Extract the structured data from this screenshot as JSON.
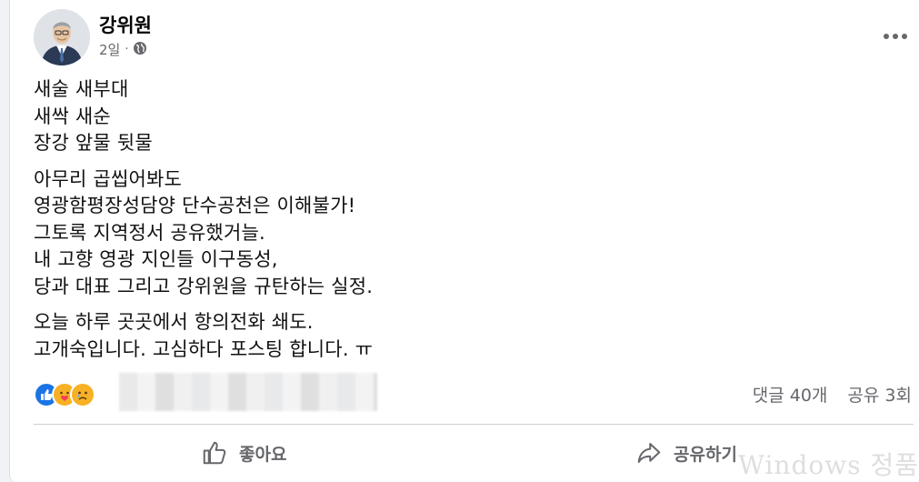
{
  "post": {
    "author": "강위원",
    "time": "2일",
    "separator": "·",
    "paragraphs": [
      [
        "새술 새부대",
        "새싹 새순",
        "장강 앞물 뒷물"
      ],
      [
        "아무리 곱씹어봐도",
        "영광함평장성담양 단수공천은 이해불가!",
        "그토록 지역정서 공유했거늘.",
        "내 고향 영광 지인들 이구동성,",
        "당과 대표 그리고 강위원을 규탄하는 실정."
      ],
      [
        "오늘 하루 곳곳에서 항의전화 쇄도.",
        "고개숙입니다. 고심하다 포스팅 합니다. ㅠ"
      ]
    ]
  },
  "stats": {
    "comments": "댓글 40개",
    "shares": "공유 3회"
  },
  "actions": {
    "like_label": "좋아요",
    "share_label": "공유하기"
  },
  "watermark": "Windows 정품"
}
